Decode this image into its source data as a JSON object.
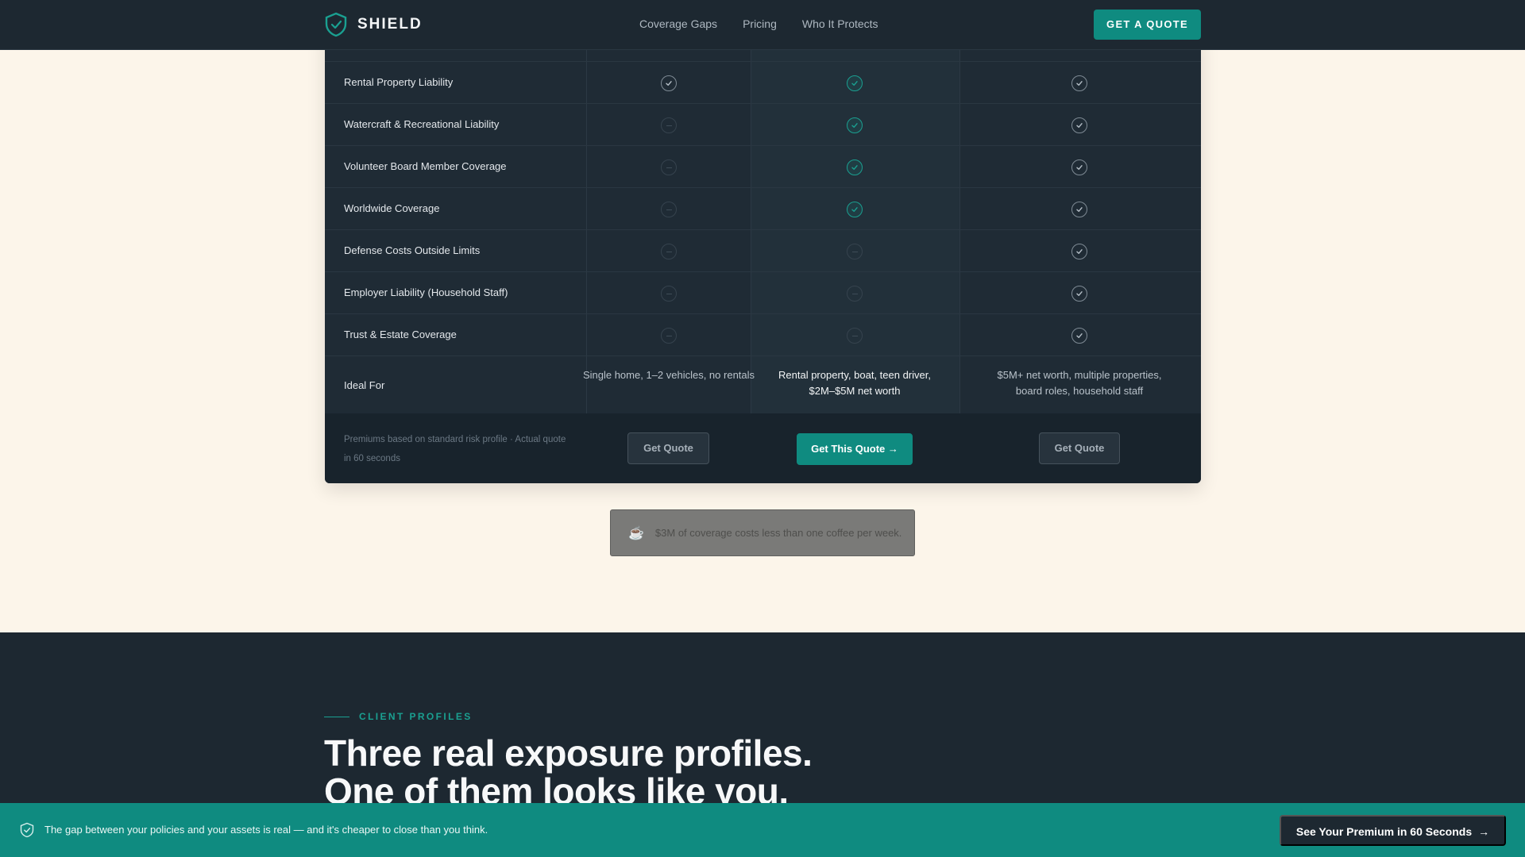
{
  "header": {
    "brand": "SHIELD",
    "nav": [
      "Coverage Gaps",
      "Pricing",
      "Who It Protects"
    ],
    "cta": "GET A QUOTE"
  },
  "table": {
    "rows": [
      {
        "label": "Rental Property Liability",
        "marks": [
          "check",
          "check",
          "check"
        ]
      },
      {
        "label": "Watercraft & Recreational Liability",
        "marks": [
          "dash",
          "check",
          "check"
        ]
      },
      {
        "label": "Volunteer Board Member Coverage",
        "marks": [
          "dash",
          "check",
          "check"
        ]
      },
      {
        "label": "Worldwide Coverage",
        "marks": [
          "dash",
          "check",
          "check"
        ]
      },
      {
        "label": "Defense Costs Outside Limits",
        "marks": [
          "dash",
          "dash",
          "check"
        ]
      },
      {
        "label": "Employer Liability (Household Staff)",
        "marks": [
          "dash",
          "dash",
          "check"
        ]
      },
      {
        "label": "Trust & Estate Coverage",
        "marks": [
          "dash",
          "dash",
          "check"
        ]
      }
    ],
    "ideal_for": {
      "label": "Ideal For",
      "values": [
        "Single home, 1–2 vehicles, no rentals",
        "Rental property, boat, teen driver, $2M–$5M net worth",
        "$5M+ net worth, multiple properties, board roles, household staff"
      ]
    },
    "footnote": "Premiums based on standard risk profile · Actual quote in 60 seconds",
    "buttons": [
      "Get Quote",
      "Get This Quote →",
      "Get Quote"
    ]
  },
  "coffee_banner": {
    "icon": "coffee-cup-icon",
    "text": "$3M of coverage costs less than one coffee per week."
  },
  "profiles": {
    "eyebrow": "CLIENT PROFILES",
    "headline_line1": "Three real exposure profiles.",
    "headline_line2": "One of them looks like you."
  },
  "sticky_bar": {
    "text": "The gap between your policies and your assets is real — and it's cheaper to close than you think.",
    "button": "See Your Premium in 60 Seconds",
    "button_arrow": "→"
  },
  "colors": {
    "accent": "#0f8b80",
    "dark": "#1d2831",
    "cream": "#fcf5ea"
  }
}
